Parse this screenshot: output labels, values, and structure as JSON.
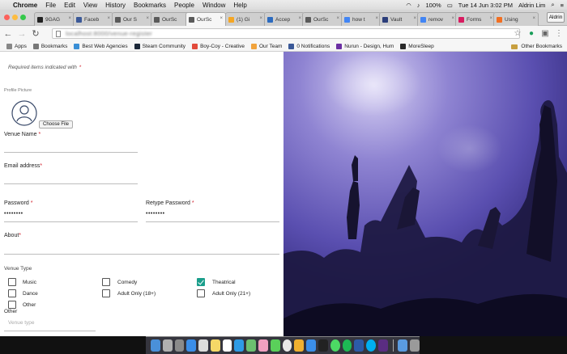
{
  "menubar": {
    "app": "Chrome",
    "items": [
      "File",
      "Edit",
      "View",
      "History",
      "Bookmarks",
      "People",
      "Window",
      "Help"
    ],
    "battery": "100%",
    "clock": "Tue 14 Jun  3:02 PM",
    "user": "Aldrin Lim"
  },
  "tabs": [
    {
      "label": "9GAG",
      "color": "#222222"
    },
    {
      "label": "Faceb",
      "color": "#3b5998"
    },
    {
      "label": "Our S",
      "color": "#5a5a5a"
    },
    {
      "label": "OurSc",
      "color": "#5a5a5a"
    },
    {
      "label": "OurSc",
      "color": "#5a5a5a",
      "active": true
    },
    {
      "label": "(1) Gi",
      "color": "#f5a623"
    },
    {
      "label": "Accep",
      "color": "#2c6bbf"
    },
    {
      "label": "OurSc",
      "color": "#5a5a5a"
    },
    {
      "label": "how t",
      "color": "#4285f4"
    },
    {
      "label": "Vault",
      "color": "#2c3e7a"
    },
    {
      "label": "remov",
      "color": "#4285f4"
    },
    {
      "label": "Forms",
      "color": "#d81b60"
    },
    {
      "label": "Using",
      "color": "#f26f21"
    }
  ],
  "profile_button": "Aldrin",
  "address_bar": {
    "url": "localhost:8000/venue-register"
  },
  "bookmarks": {
    "items": [
      {
        "label": "Apps",
        "color": "#888888"
      },
      {
        "label": "Bookmarks",
        "color": "#777777"
      },
      {
        "label": "Best Web Agencies",
        "color": "#3a8fd6"
      },
      {
        "label": "Steam Community",
        "color": "#1b2838"
      },
      {
        "label": "Boy-Coy - Creative",
        "color": "#e24a3b"
      },
      {
        "label": "Our Team",
        "color": "#f1a33c"
      },
      {
        "label": "0 Notifications",
        "color": "#3b5998"
      },
      {
        "label": "Nurun - Design, Hum",
        "color": "#6b2fa3"
      },
      {
        "label": "MoreSleep",
        "color": "#2a2a2a"
      }
    ],
    "other": "Other Bookmarks"
  },
  "form": {
    "required_note": "Required items indicated with",
    "required_star": "*",
    "profile_picture_label": "Profile Picture",
    "choose_file": "Choose File",
    "venue_name_label": "Venue Name",
    "email_label": "Email address",
    "password_label": "Password",
    "password_value": "••••••••",
    "retype_label": "Retype Password",
    "retype_value": "••••••••",
    "about_label": "About",
    "venue_type_label": "Venue Type",
    "options": [
      {
        "label": "Music",
        "checked": false
      },
      {
        "label": "Comedy",
        "checked": false
      },
      {
        "label": "Theatrical",
        "checked": true
      },
      {
        "label": "Dance",
        "checked": false
      },
      {
        "label": "Adult Only (18+)",
        "checked": false
      },
      {
        "label": "Adult Only (21+)",
        "checked": false
      },
      {
        "label": "Other",
        "checked": false
      }
    ],
    "other_heading": "Other",
    "venue_type_placeholder": "Venue type"
  },
  "colors": {
    "accent_red": "#d21f2a",
    "checkbox_teal": "#1a9e8b",
    "photo_tint": "#5a4fb0"
  },
  "dock_apps": [
    "finder",
    "launchpad",
    "system-preferences",
    "safari",
    "preview",
    "notes",
    "calendar",
    "app-store",
    "maps",
    "photos",
    "messages",
    "chrome",
    "sketch",
    "safari-alt",
    "terminal",
    "facetime",
    "spotify",
    "photoshop",
    "skype",
    "slack",
    "downloads",
    "trash"
  ]
}
